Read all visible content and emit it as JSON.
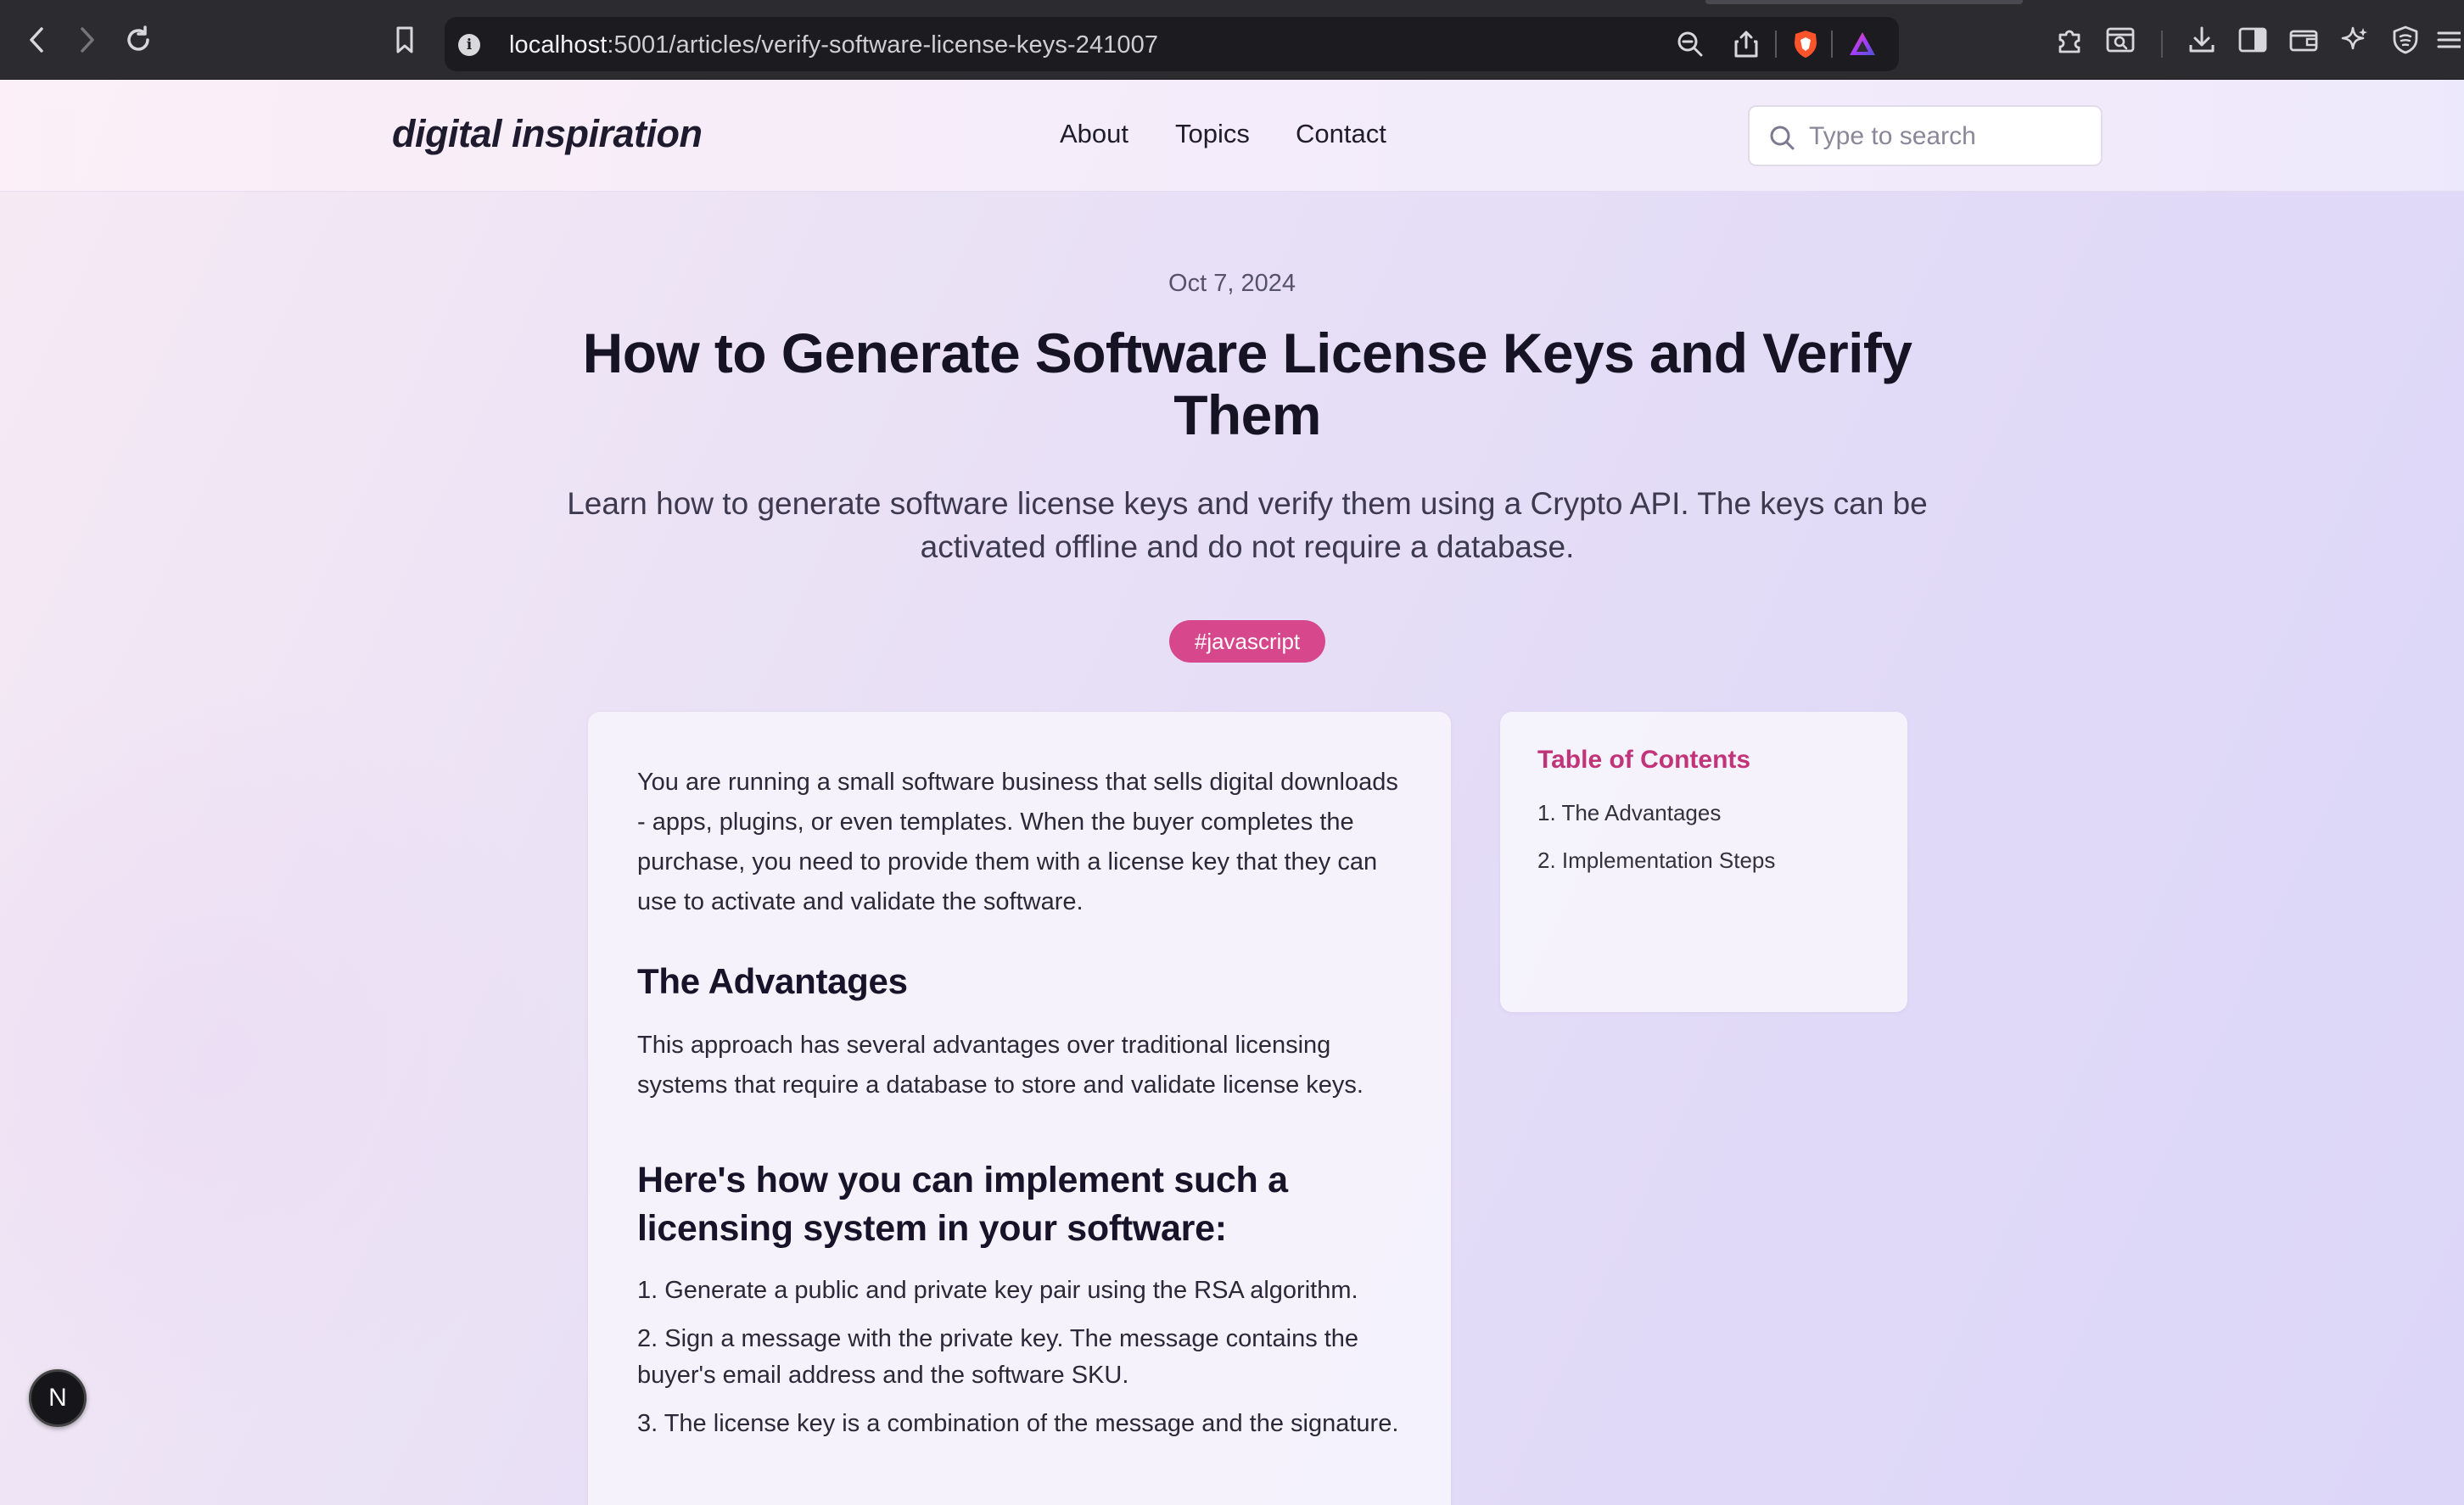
{
  "browser": {
    "url_host": "localhost",
    "url_rest": ":5001/articles/verify-software-license-keys-241007",
    "icons": [
      "back-icon",
      "forward-icon",
      "reload-icon",
      "bookmark-icon",
      "info-icon",
      "zoom-out-icon",
      "share-icon",
      "brave-shield-icon",
      "brave-rewards-icon",
      "extensions-icon",
      "tab-search-icon",
      "download-icon",
      "sidebar-icon",
      "wallet-icon",
      "leo-ai-icon",
      "vpn-icon",
      "menu-icon"
    ]
  },
  "header": {
    "logo": "digital inspiration",
    "nav": [
      "About",
      "Topics",
      "Contact"
    ],
    "search_placeholder": "Type to search"
  },
  "article": {
    "date": "Oct 7, 2024",
    "title": "How to Generate Software License Keys and Verify Them",
    "subtitle": "Learn how to generate software license keys and verify them using a Crypto API. The keys can be activated offline and do not require a database.",
    "tag": "#javascript",
    "intro": "You are running a small software business that sells digital downloads - apps, plugins, or even templates. When the buyer completes the purchase, you need to provide them with a license key that they can use to activate and validate the software.",
    "advantages_heading": "The Advantages",
    "advantages_text": "This approach has several advantages over traditional licensing systems that require a database to store and validate license keys.",
    "impl_heading": "Here's how you can implement such a licensing system in your software:",
    "steps": [
      "1. Generate a public and private key pair using the RSA algorithm.",
      "2. Sign a message with the private key. The message contains the buyer's email address and the software SKU.",
      "3. The license key is a combination of the message and the signature."
    ]
  },
  "toc": {
    "title": "Table of Contents",
    "items": [
      "1. The Advantages",
      "2. Implementation Steps"
    ]
  },
  "dev_badge": "N",
  "colors": {
    "accent": "#d6478b",
    "toc_title": "#c2347a",
    "chrome_bg": "#2c2b30"
  }
}
